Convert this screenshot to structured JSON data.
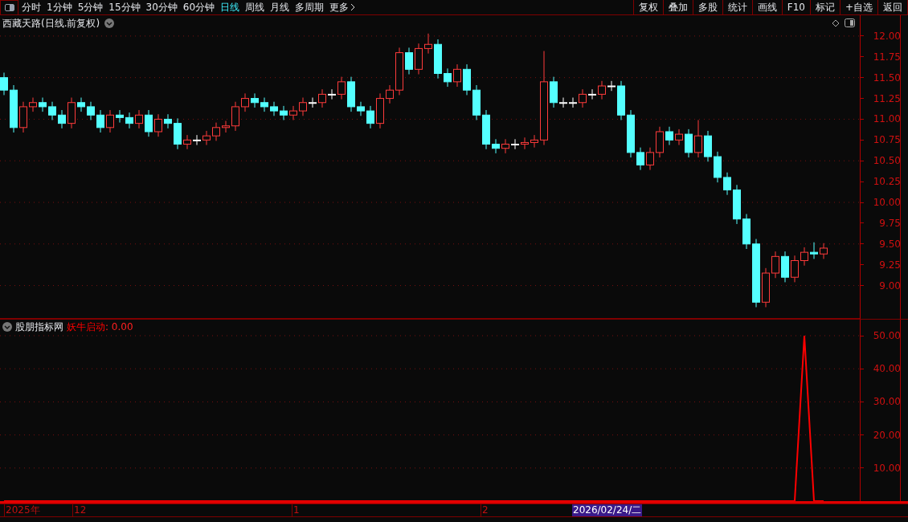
{
  "toolbar": {
    "periods": [
      {
        "label": "分时",
        "selected": false
      },
      {
        "label": "1分钟",
        "selected": false
      },
      {
        "label": "5分钟",
        "selected": false
      },
      {
        "label": "15分钟",
        "selected": false
      },
      {
        "label": "30分钟",
        "selected": false
      },
      {
        "label": "60分钟",
        "selected": false
      },
      {
        "label": "日线",
        "selected": true
      },
      {
        "label": "周线",
        "selected": false
      },
      {
        "label": "月线",
        "selected": false
      },
      {
        "label": "多周期",
        "selected": false
      }
    ],
    "more": "更多",
    "actions": [
      "复权",
      "叠加",
      "多股",
      "统计",
      "画线",
      "F10",
      "标记",
      "+自选",
      "返回"
    ]
  },
  "main_chart": {
    "title": "西藏天路(日线.前复权)",
    "chart_data": {
      "type": "candlestick",
      "grid": true,
      "ylim": [
        8.6,
        12.25
      ],
      "yticks": [
        {
          "value": 12,
          "label": "12.00"
        },
        {
          "value": 11.75,
          "label": "11.75"
        },
        {
          "value": 11.5,
          "label": "11.50"
        },
        {
          "value": 11.25,
          "label": "11.25"
        },
        {
          "value": 11,
          "label": "11.00"
        },
        {
          "value": 10.75,
          "label": "10.75"
        },
        {
          "value": 10.5,
          "label": "10.50"
        },
        {
          "value": 10.25,
          "label": "10.25"
        },
        {
          "value": 10,
          "label": "10.00"
        },
        {
          "value": 9.75,
          "label": "9.75"
        },
        {
          "value": 9.5,
          "label": "9.50"
        },
        {
          "value": 9.25,
          "label": "9.25"
        },
        {
          "value": 9,
          "label": "9.00"
        }
      ],
      "ohlc": [
        [
          11.5,
          11.56,
          11.29,
          11.35
        ],
        [
          11.35,
          11.41,
          10.84,
          10.9
        ],
        [
          10.9,
          11.21,
          10.84,
          11.15
        ],
        [
          11.15,
          11.26,
          11.09,
          11.2
        ],
        [
          11.2,
          11.26,
          11.09,
          11.15
        ],
        [
          11.15,
          11.21,
          10.99,
          11.05
        ],
        [
          11.05,
          11.11,
          10.89,
          10.95
        ],
        [
          10.95,
          11.26,
          10.89,
          11.2
        ],
        [
          11.2,
          11.26,
          11.09,
          11.15
        ],
        [
          11.15,
          11.21,
          10.99,
          11.05
        ],
        [
          11.05,
          11.11,
          10.84,
          10.9
        ],
        [
          10.9,
          11.11,
          10.84,
          11.05
        ],
        [
          11.05,
          11.11,
          10.96,
          11.02
        ],
        [
          11.02,
          11.08,
          10.89,
          10.95
        ],
        [
          10.95,
          11.11,
          10.89,
          11.05
        ],
        [
          11.05,
          11.11,
          10.79,
          10.85
        ],
        [
          10.85,
          11.06,
          10.79,
          11.0
        ],
        [
          11.0,
          11.06,
          10.89,
          10.95
        ],
        [
          10.95,
          11.01,
          10.64,
          10.7
        ],
        [
          10.7,
          10.81,
          10.64,
          10.75
        ],
        [
          10.75,
          10.81,
          10.69,
          10.75
        ],
        [
          10.75,
          10.86,
          10.69,
          10.8
        ],
        [
          10.8,
          10.96,
          10.74,
          10.9
        ],
        [
          10.9,
          10.98,
          10.84,
          10.92
        ],
        [
          10.92,
          11.21,
          10.86,
          11.15
        ],
        [
          11.15,
          11.31,
          11.09,
          11.25
        ],
        [
          11.25,
          11.31,
          11.14,
          11.2
        ],
        [
          11.2,
          11.26,
          11.09,
          11.15
        ],
        [
          11.15,
          11.21,
          11.04,
          11.1
        ],
        [
          11.1,
          11.16,
          10.99,
          11.05
        ],
        [
          11.05,
          11.16,
          10.99,
          11.1
        ],
        [
          11.1,
          11.26,
          11.04,
          11.2
        ],
        [
          11.2,
          11.26,
          11.14,
          11.2
        ],
        [
          11.2,
          11.36,
          11.14,
          11.3
        ],
        [
          11.3,
          11.36,
          11.24,
          11.3
        ],
        [
          11.3,
          11.51,
          11.24,
          11.45
        ],
        [
          11.45,
          11.51,
          11.09,
          11.15
        ],
        [
          11.15,
          11.21,
          11.04,
          11.1
        ],
        [
          11.1,
          11.16,
          10.89,
          10.95
        ],
        [
          10.95,
          11.31,
          10.89,
          11.25
        ],
        [
          11.25,
          11.41,
          11.19,
          11.35
        ],
        [
          11.35,
          11.86,
          11.29,
          11.8
        ],
        [
          11.8,
          11.86,
          11.54,
          11.6
        ],
        [
          11.6,
          11.91,
          11.54,
          11.85
        ],
        [
          11.85,
          12.03,
          11.79,
          11.9
        ],
        [
          11.9,
          11.96,
          11.49,
          11.55
        ],
        [
          11.55,
          11.61,
          11.39,
          11.45
        ],
        [
          11.45,
          11.66,
          11.39,
          11.6
        ],
        [
          11.6,
          11.66,
          11.29,
          11.35
        ],
        [
          11.35,
          11.41,
          10.99,
          11.05
        ],
        [
          11.05,
          11.11,
          10.64,
          10.7
        ],
        [
          10.7,
          10.76,
          10.59,
          10.65
        ],
        [
          10.65,
          10.76,
          10.59,
          10.7
        ],
        [
          10.7,
          10.76,
          10.64,
          10.7
        ],
        [
          10.7,
          10.78,
          10.64,
          10.72
        ],
        [
          10.72,
          10.81,
          10.66,
          10.75
        ],
        [
          10.75,
          11.82,
          10.69,
          11.45
        ],
        [
          11.45,
          11.51,
          11.14,
          11.2
        ],
        [
          11.2,
          11.26,
          11.14,
          11.2
        ],
        [
          11.2,
          11.26,
          11.14,
          11.2
        ],
        [
          11.2,
          11.36,
          11.14,
          11.3
        ],
        [
          11.3,
          11.36,
          11.24,
          11.3
        ],
        [
          11.3,
          11.46,
          11.24,
          11.4
        ],
        [
          11.4,
          11.46,
          11.34,
          11.4
        ],
        [
          11.4,
          11.46,
          10.99,
          11.05
        ],
        [
          11.05,
          11.11,
          10.54,
          10.6
        ],
        [
          10.6,
          10.66,
          10.39,
          10.45
        ],
        [
          10.45,
          10.66,
          10.39,
          10.6
        ],
        [
          10.6,
          10.91,
          10.54,
          10.85
        ],
        [
          10.85,
          10.91,
          10.69,
          10.75
        ],
        [
          10.75,
          10.88,
          10.69,
          10.82
        ],
        [
          10.82,
          10.88,
          10.54,
          10.6
        ],
        [
          10.6,
          10.99,
          10.54,
          10.8
        ],
        [
          10.8,
          10.86,
          10.49,
          10.55
        ],
        [
          10.55,
          10.61,
          10.24,
          10.3
        ],
        [
          10.3,
          10.36,
          10.09,
          10.15
        ],
        [
          10.15,
          10.21,
          9.74,
          9.8
        ],
        [
          9.8,
          9.86,
          9.44,
          9.5
        ],
        [
          9.5,
          9.56,
          8.74,
          8.8
        ],
        [
          8.8,
          9.21,
          8.74,
          9.15
        ],
        [
          9.15,
          9.41,
          9.09,
          9.35
        ],
        [
          9.35,
          9.41,
          9.04,
          9.1
        ],
        [
          9.1,
          9.36,
          9.04,
          9.3
        ],
        [
          9.3,
          9.46,
          9.24,
          9.4
        ],
        [
          9.4,
          9.52,
          9.32,
          9.38
        ],
        [
          9.38,
          9.51,
          9.32,
          9.45
        ]
      ]
    }
  },
  "indicator": {
    "name": "股朋指标网",
    "reading": ": 0.00",
    "chart_data": {
      "type": "line",
      "grid": true,
      "ylim": [
        0,
        50
      ],
      "yticks": [
        {
          "value": 10,
          "label": "10.00"
        },
        {
          "value": 20,
          "label": "20.00"
        },
        {
          "value": 30,
          "label": "30.00"
        },
        {
          "value": 40,
          "label": "40.00"
        },
        {
          "value": 50,
          "label": "50.00"
        }
      ],
      "series": [
        {
          "name": "妖牛启动",
          "color": "#ff0000",
          "values": [
            0,
            0,
            0,
            0,
            0,
            0,
            0,
            0,
            0,
            0,
            0,
            0,
            0,
            0,
            0,
            0,
            0,
            0,
            0,
            0,
            0,
            0,
            0,
            0,
            0,
            0,
            0,
            0,
            0,
            0,
            0,
            0,
            0,
            0,
            0,
            0,
            0,
            0,
            0,
            0,
            0,
            0,
            0,
            0,
            0,
            0,
            0,
            0,
            0,
            0,
            0,
            0,
            0,
            0,
            0,
            0,
            0,
            0,
            0,
            0,
            0,
            0,
            0,
            0,
            0,
            0,
            0,
            0,
            0,
            0,
            0,
            0,
            0,
            0,
            0,
            0,
            0,
            0,
            0,
            0,
            0,
            0,
            0,
            50,
            0,
            0
          ]
        }
      ]
    }
  },
  "date_axis": {
    "labels": [
      "2025年",
      "12",
      "1",
      "2"
    ],
    "cursor_date": "2026/02/24/二"
  }
}
